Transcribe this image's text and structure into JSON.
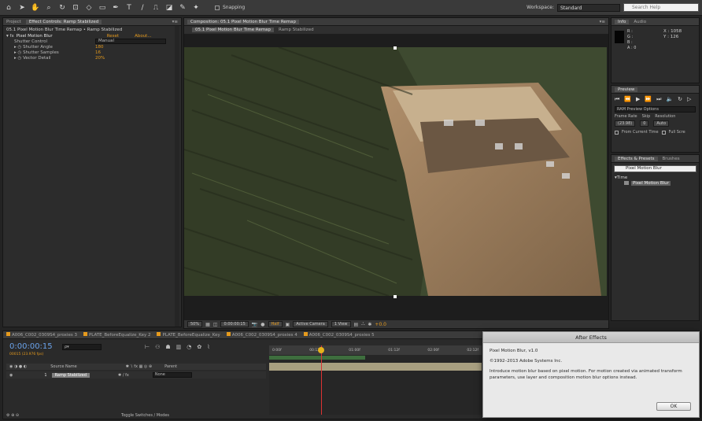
{
  "toolbar": {
    "snapping_label": "Snapping",
    "workspace_label": "Workspace:",
    "workspace_value": "Standard",
    "search_placeholder": "Search Help"
  },
  "left_panel": {
    "tabs": [
      "Project",
      "Effect Controls: Ramp Stabilized"
    ],
    "breadcrumb": "05.1 Pixel Motion Blur Time Remap • Ramp Stabilized",
    "effect": {
      "name": "Pixel Motion Blur",
      "reset": "Reset",
      "about": "About..."
    },
    "properties": [
      {
        "label": "Shutter Control",
        "value": "Manual"
      },
      {
        "label": "Shutter Angle",
        "value": "180"
      },
      {
        "label": "Shutter Samples",
        "value": "16"
      },
      {
        "label": "Vector Detail",
        "value": "20%"
      }
    ]
  },
  "composition": {
    "tab_label": "Composition: 05.1 Pixel Motion Blur Time Remap",
    "sub_tabs": [
      "05.1 Pixel Motion Blur Time Remap",
      "Ramp Stabilized"
    ],
    "footer": {
      "zoom": "50%",
      "timecode": "0:00:00:15",
      "quality": "Half",
      "camera": "Active Camera",
      "views": "1 View",
      "exposure": "+0.0"
    }
  },
  "info_panel": {
    "tabs": [
      "Info",
      "Audio"
    ],
    "r": "R :",
    "g": "G :",
    "b": "B :",
    "a": "A : 0",
    "x": "X : 1058",
    "y": "Y : 126"
  },
  "preview_panel": {
    "tab": "Preview",
    "ram_label": "RAM Preview Options",
    "frame_rate_label": "Frame Rate",
    "skip_label": "Skip",
    "resolution_label": "Resolution",
    "frame_rate_value": "(23.98)",
    "skip_value": "0",
    "resolution_value": "Auto",
    "from_current": "From Current Time",
    "full_screen": "Full Scre"
  },
  "effects_panel": {
    "tabs": [
      "Effects & Presets",
      "Brushes"
    ],
    "search_value": "Pixel Motion Blur",
    "category": "Time",
    "item": "Pixel Motion Blur"
  },
  "timeline": {
    "tabs": [
      "A006_C002_0309S4_proxies 3",
      "PLATE_BeforeEqualize_Key 2",
      "PLATE_BeforeEqualize_Key",
      "A006_C002_0309S4_proxies 4",
      "A006_C002_0309S4_proxies 5"
    ],
    "timecode": "0:00:00:15",
    "fps_label": "00015 (23.976 fps)",
    "search_placeholder": "ρ▾",
    "columns": {
      "source_name": "Source Name",
      "parent": "Parent"
    },
    "layer_number": "1",
    "layer_name": "Ramp Stabilized",
    "parent_value": "None",
    "ruler_labels": [
      "0:00f",
      "00:12f",
      "01:00f",
      "01:12f",
      "02:00f",
      "02:12f"
    ],
    "toggle_label": "Toggle Switches / Modes"
  },
  "dialog": {
    "title": "After Effects",
    "heading": "Pixel Motion Blur, v1.0",
    "copyright": "©1992–2013 Adobe Systems Inc.",
    "body": "Introduce motion blur based on pixel motion. For motion created via animated transform parameters, use layer and composition motion blur options instead.",
    "ok_label": "OK"
  },
  "colors": {
    "accent_orange": "#e59a1d",
    "timecode_blue": "#6aa2ea",
    "panel_bg": "#2c2c2c"
  }
}
